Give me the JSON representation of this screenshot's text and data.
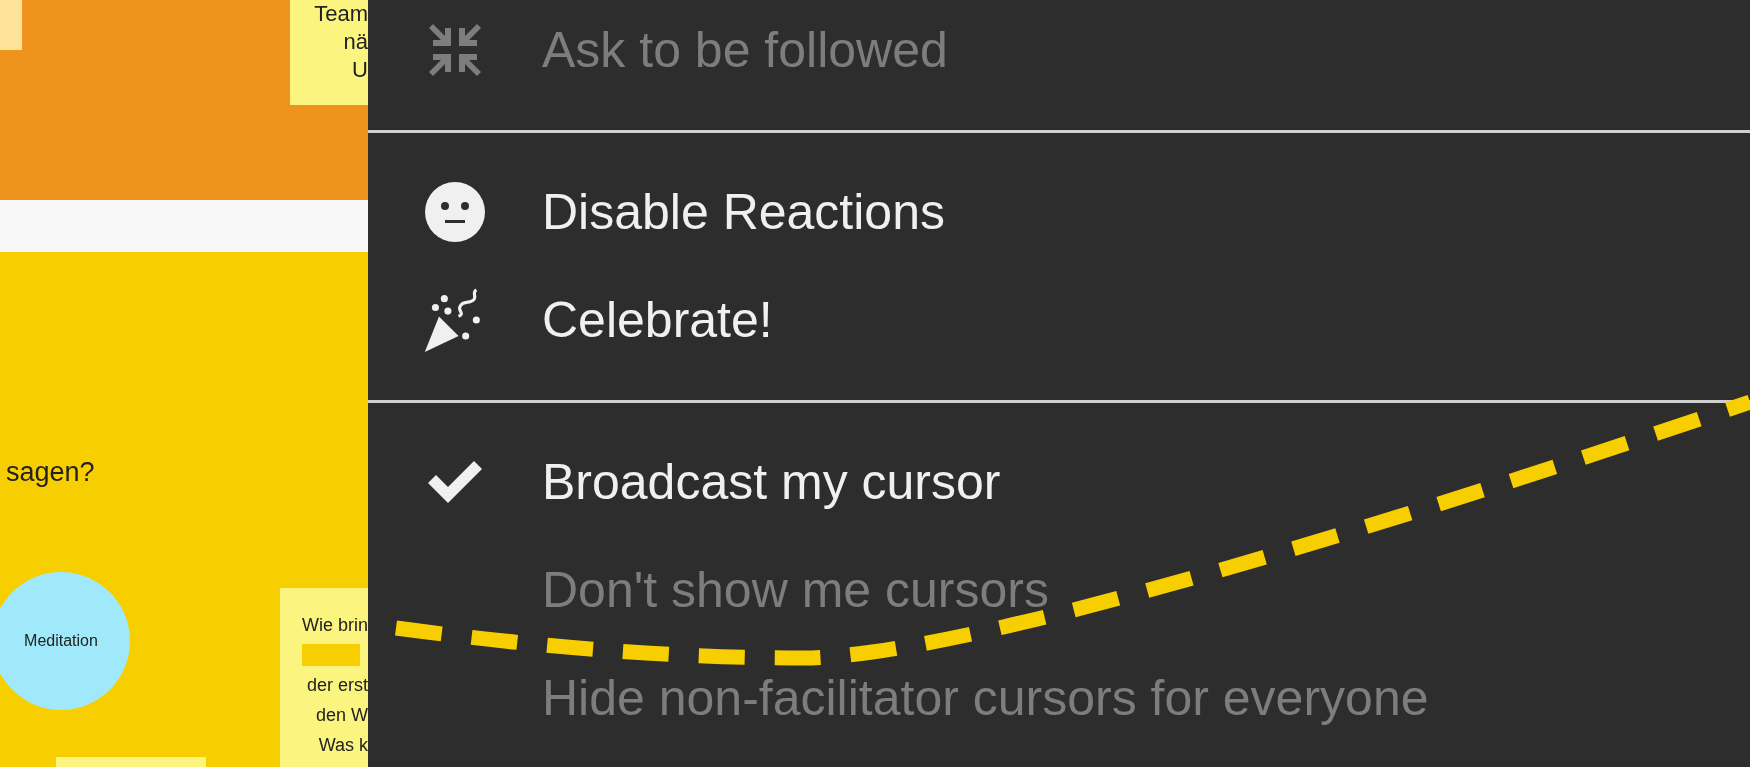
{
  "canvas": {
    "top_note": {
      "lines": [
        "Team",
        "nä",
        "U"
      ]
    },
    "question": "sagen?",
    "circle": {
      "label": "Meditation"
    },
    "bottom_note": {
      "lines": [
        "Wie brin",
        "der erst",
        "den W",
        "Was k"
      ]
    }
  },
  "menu": {
    "sections": [
      [
        {
          "kind": "collapse",
          "label": "Ask to be followed",
          "disabled": true
        }
      ],
      [
        {
          "kind": "face",
          "label": "Disable Reactions",
          "disabled": false
        },
        {
          "kind": "party",
          "label": "Celebrate!",
          "disabled": false
        }
      ],
      [
        {
          "kind": "check",
          "label": "Broadcast my cursor",
          "disabled": false,
          "checked": true
        },
        {
          "kind": "check",
          "label": "Don't show me cursors",
          "disabled": true,
          "checked": false
        },
        {
          "kind": "check",
          "label": "Hide non-facilitator cursors for everyone",
          "disabled": true,
          "checked": false
        }
      ]
    ]
  }
}
